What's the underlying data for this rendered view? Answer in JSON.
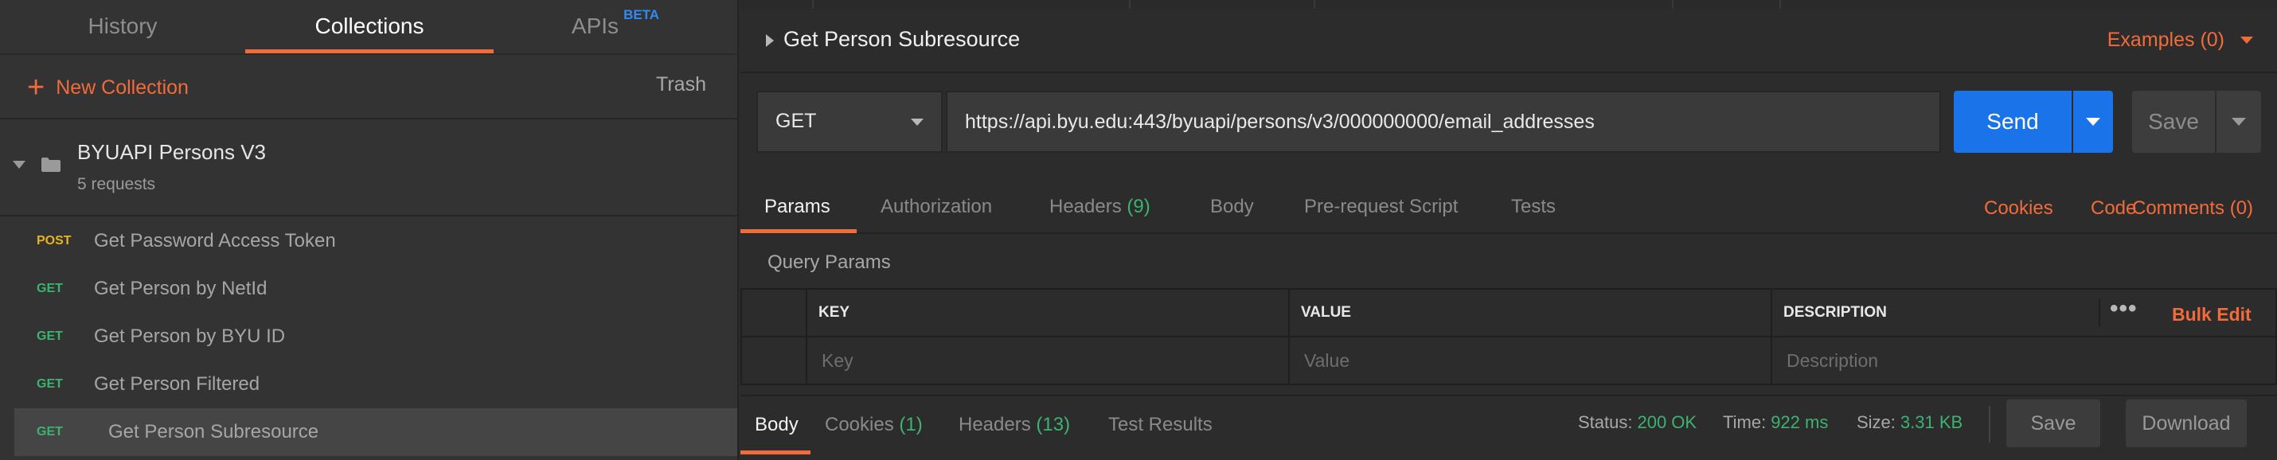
{
  "sidebar": {
    "tabs": [
      {
        "label": "History"
      },
      {
        "label": "Collections"
      },
      {
        "label": "APIs",
        "badge": "BETA"
      }
    ],
    "new_collection_label": "New Collection",
    "trash_label": "Trash",
    "collection": {
      "name": "BYUAPI Persons V3",
      "count": "5 requests"
    },
    "requests": [
      {
        "method": "POST",
        "name": "Get Password Access Token"
      },
      {
        "method": "GET",
        "name": "Get Person by NetId"
      },
      {
        "method": "GET",
        "name": "Get Person by BYU ID"
      },
      {
        "method": "GET",
        "name": "Get Person Filtered"
      },
      {
        "method": "GET",
        "name": "Get Person Subresource"
      }
    ]
  },
  "request": {
    "title": "Get Person Subresource",
    "examples": "Examples (0)",
    "method": "GET",
    "url": "https://api.byu.edu:443/byuapi/persons/v3/000000000/email_addresses",
    "send_label": "Send",
    "save_label": "Save"
  },
  "req_tabs": {
    "params": "Params",
    "authorization": "Authorization",
    "headers": "Headers",
    "headers_count": "(9)",
    "body": "Body",
    "prerequest": "Pre-request Script",
    "tests": "Tests",
    "cookies": "Cookies",
    "code": "Code",
    "comments": "Comments (0)"
  },
  "query_params": {
    "label": "Query Params",
    "headers": {
      "key": "KEY",
      "value": "VALUE",
      "description": "DESCRIPTION"
    },
    "bulk_edit": "Bulk Edit",
    "dots": "•••",
    "placeholders": {
      "key": "Key",
      "value": "Value",
      "description": "Description"
    }
  },
  "response": {
    "tabs": {
      "body": "Body",
      "cookies": "Cookies",
      "cookies_count": "(1)",
      "headers": "Headers",
      "headers_count": "(13)",
      "test_results": "Test Results"
    },
    "status_label": "Status:",
    "status_value": "200 OK",
    "time_label": "Time:",
    "time_value": "922 ms",
    "size_label": "Size:",
    "size_value": "3.31 KB",
    "save_label": "Save",
    "download_label": "Download"
  },
  "colors": {
    "accent": "#f26b3a",
    "send_blue": "#1a73e8",
    "get_green": "#3cb371",
    "post_yellow": "#e5b41e"
  }
}
